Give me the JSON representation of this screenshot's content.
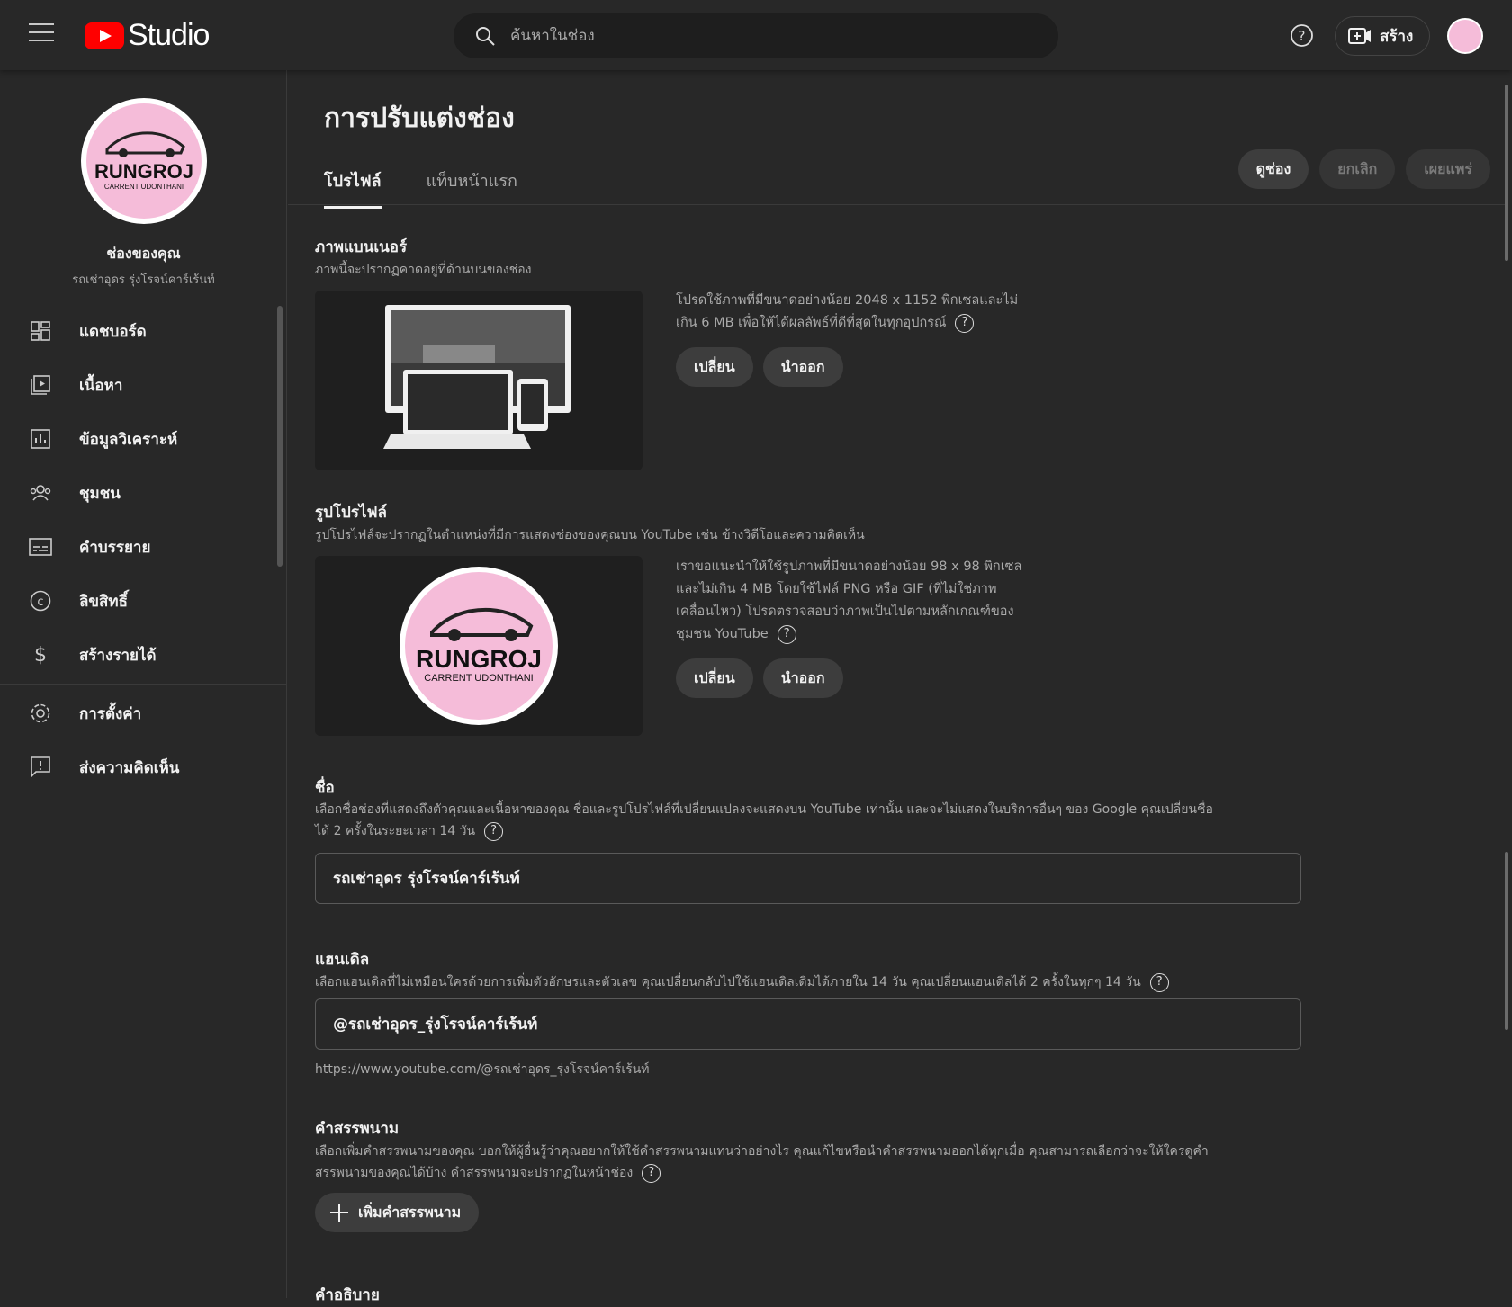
{
  "header": {
    "logo_text": "Studio",
    "search_placeholder": "ค้นหาในช่อง",
    "create_label": "สร้าง"
  },
  "sidebar": {
    "channel_title": "ช่องของคุณ",
    "channel_name": "รถเช่าอุดร รุ่งโรจน์คาร์เร้นท์",
    "avatar_text_main": "RUNGROJ",
    "avatar_text_sub": "CARRENT UDONTHANI",
    "items": [
      {
        "label": "แดชบอร์ด",
        "icon": "dashboard-icon"
      },
      {
        "label": "เนื้อหา",
        "icon": "content-icon"
      },
      {
        "label": "ข้อมูลวิเคราะห์",
        "icon": "analytics-icon"
      },
      {
        "label": "ชุมชน",
        "icon": "community-icon"
      },
      {
        "label": "คำบรรยาย",
        "icon": "subtitles-icon"
      },
      {
        "label": "ลิขสิทธิ์",
        "icon": "copyright-icon"
      },
      {
        "label": "สร้างรายได้",
        "icon": "dollar-icon"
      }
    ],
    "bottom_items": [
      {
        "label": "การตั้งค่า",
        "icon": "gear-icon"
      },
      {
        "label": "ส่งความคิดเห็น",
        "icon": "feedback-icon"
      }
    ]
  },
  "main": {
    "page_title": "การปรับแต่งช่อง",
    "tabs": [
      {
        "label": "โปรไฟล์",
        "active": true
      },
      {
        "label": "แท็บหน้าแรก",
        "active": false
      }
    ],
    "actions": {
      "view_channel": "ดูช่อง",
      "cancel": "ยกเลิก",
      "publish": "เผยแพร่"
    },
    "banner": {
      "title": "ภาพแบนเนอร์",
      "desc": "ภาพนี้จะปรากฏคาดอยู่ที่ด้านบนของช่อง",
      "info_line1": "โปรดใช้ภาพที่มีขนาดอย่างน้อย 2048 x 1152 พิกเซลและไม่",
      "info_line2": "เกิน 6 MB เพื่อให้ได้ผลลัพธ์ที่ดีที่สุดในทุกอุปกรณ์",
      "change": "เปลี่ยน",
      "remove": "นำออก"
    },
    "picture": {
      "title": "รูปโปรไฟล์",
      "desc": "รูปโปรไฟล์จะปรากฏในตำแหน่งที่มีการแสดงช่องของคุณบน YouTube เช่น ข้างวิดีโอและความคิดเห็น",
      "info_line1": "เราขอแนะนำให้ใช้รูปภาพที่มีขนาดอย่างน้อย 98 x 98 พิกเซล",
      "info_line2": "และไม่เกิน 4 MB โดยใช้ไฟล์ PNG หรือ GIF (ที่ไม่ใช่ภาพ",
      "info_line3": "เคลื่อนไหว) โปรดตรวจสอบว่าภาพเป็นไปตามหลักเกณฑ์ของ",
      "info_line4": "ชุมชน YouTube",
      "change": "เปลี่ยน",
      "remove": "นำออก"
    },
    "name": {
      "title": "ชื่อ",
      "desc_line1": "เลือกชื่อช่องที่แสดงถึงตัวคุณและเนื้อหาของคุณ ชื่อและรูปโปรไฟล์ที่เปลี่ยนแปลงจะแสดงบน YouTube เท่านั้น และจะไม่แสดงในบริการอื่นๆ ของ Google คุณเปลี่ยนชื่อ",
      "desc_line2": "ได้ 2 ครั้งในระยะเวลา 14 วัน",
      "value": "รถเช่าอุดร รุ่งโรจน์คาร์เร้นท์"
    },
    "handle": {
      "title": "แฮนเดิล",
      "desc": "เลือกแฮนเดิลที่ไม่เหมือนใครด้วยการเพิ่มตัวอักษรและตัวเลข คุณเปลี่ยนกลับไปใช้แฮนเดิลเดิมได้ภายใน 14 วัน คุณเปลี่ยนแฮนเดิลได้ 2 ครั้งในทุกๆ 14 วัน",
      "value": "@รถเช่าอุดร_รุ่งโรจน์คาร์เร้นท์",
      "url": "https://www.youtube.com/@รถเช่าอุดร_รุ่งโรจน์คาร์เร้นท์"
    },
    "pronouns": {
      "title": "คำสรรพนาม",
      "desc_line1": "เลือกเพิ่มคำสรรพนามของคุณ บอกให้ผู้อื่นรู้ว่าคุณอยากให้ใช้คำสรรพนามแทนว่าอย่างไร คุณแก้ไขหรือนำคำสรรพนามออกได้ทุกเมื่อ คุณสามารถเลือกว่าจะให้ใครดูคำ",
      "desc_line2": "สรรพนามของคุณได้บ้าง คำสรรพนามจะปรากฏในหน้าช่อง",
      "add_label": "เพิ่มคำสรรพนาม"
    },
    "description": {
      "title": "คำอธิบาย"
    }
  },
  "colors": {
    "background": "#282828",
    "brand_red": "#ff0000",
    "avatar_pink": "#f5bcd9"
  }
}
